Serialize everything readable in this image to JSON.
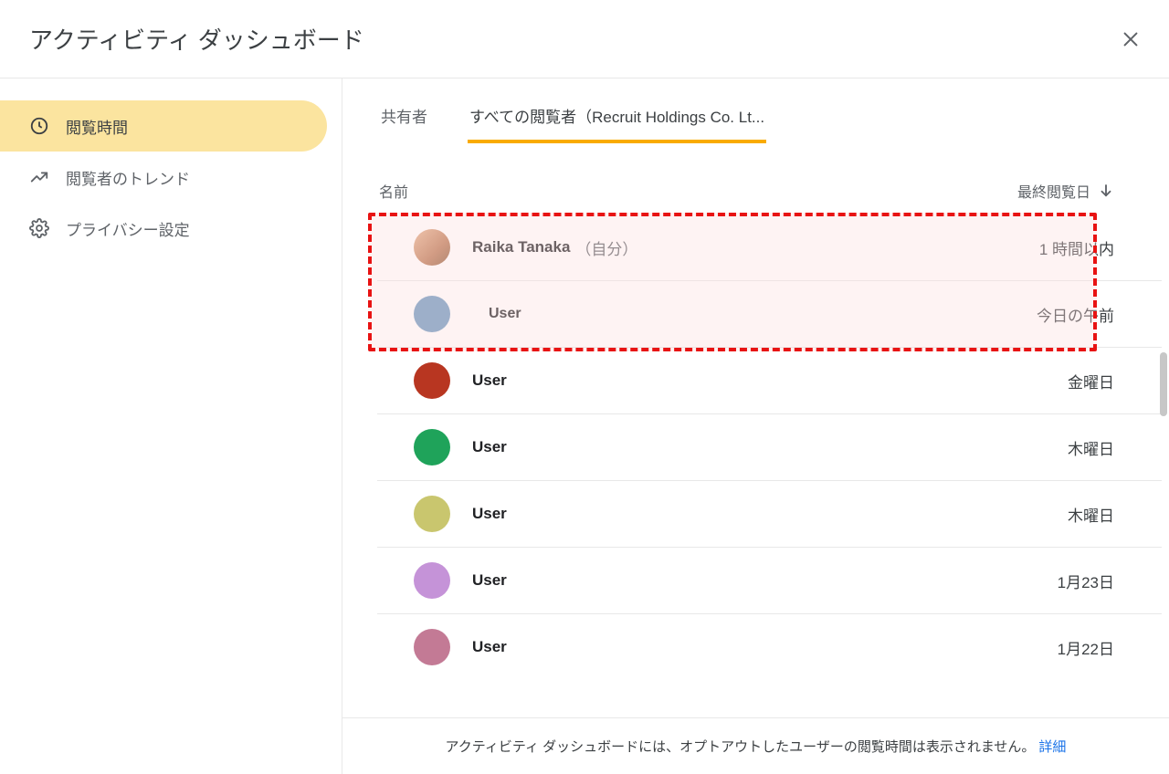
{
  "dialog": {
    "title": "アクティビティ ダッシュボード"
  },
  "sidebar": {
    "items": [
      {
        "label": "閲覧時間",
        "icon": "clock",
        "active": true
      },
      {
        "label": "閲覧者のトレンド",
        "icon": "trend",
        "active": false
      },
      {
        "label": "プライバシー設定",
        "icon": "gear",
        "active": false
      }
    ]
  },
  "tabs": [
    {
      "label": "共有者",
      "active": false
    },
    {
      "label": "すべての閲覧者（Recruit Holdings Co. Lt...",
      "active": true
    }
  ],
  "table": {
    "name_header": "名前",
    "last_header": "最終閲覧日",
    "rows": [
      {
        "name": "Raika Tanaka",
        "suffix": "（自分）",
        "time": "1 時間以内",
        "avatar": "photo",
        "pill": false
      },
      {
        "name": "User",
        "suffix": "",
        "time": "今日の午前",
        "avatar": "#6a97bf",
        "pill": true
      },
      {
        "name": "User",
        "suffix": "",
        "time": "金曜日",
        "avatar": "#b83621",
        "pill": false
      },
      {
        "name": "User",
        "suffix": "",
        "time": "木曜日",
        "avatar": "#1fa35a",
        "pill": false
      },
      {
        "name": "User",
        "suffix": "",
        "time": "木曜日",
        "avatar": "#c9c66e",
        "pill": false
      },
      {
        "name": "User",
        "suffix": "",
        "time": "1月23日",
        "avatar": "#c593d8",
        "pill": false
      },
      {
        "name": "User",
        "suffix": "",
        "time": "1月22日",
        "avatar": "#c37a95",
        "pill": false
      }
    ]
  },
  "footer": {
    "text": "アクティビティ ダッシュボードには、オプトアウトしたユーザーの閲覧時間は表示されません。",
    "link": "詳細"
  }
}
